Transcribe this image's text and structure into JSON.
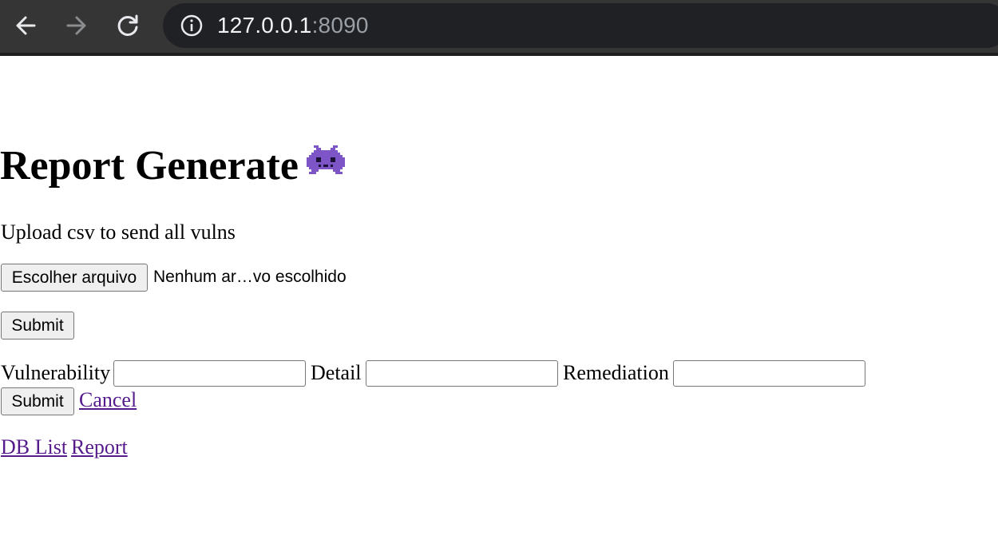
{
  "browser": {
    "url_host": "127.0.0.1",
    "url_port": ":8090"
  },
  "page": {
    "title": "Report Generate",
    "emoji_icon": "alien-monster-icon",
    "description": "Upload csv to send all vulns"
  },
  "upload_form": {
    "file_button_label": "Escolher arquivo",
    "file_status": "Nenhum ar…vo escolhido",
    "submit_label": "Submit"
  },
  "manual_form": {
    "vulnerability_label": "Vulnerability",
    "vulnerability_value": "",
    "detail_label": "Detail",
    "detail_value": "",
    "remediation_label": "Remediation",
    "remediation_value": "",
    "submit_label": "Submit",
    "cancel_label": "Cancel"
  },
  "footer_links": {
    "db_list": "DB List",
    "report": "Report"
  },
  "colors": {
    "link_visited": "#551a8b",
    "browser_chrome": "#353535",
    "alien": "#7d55c7"
  }
}
